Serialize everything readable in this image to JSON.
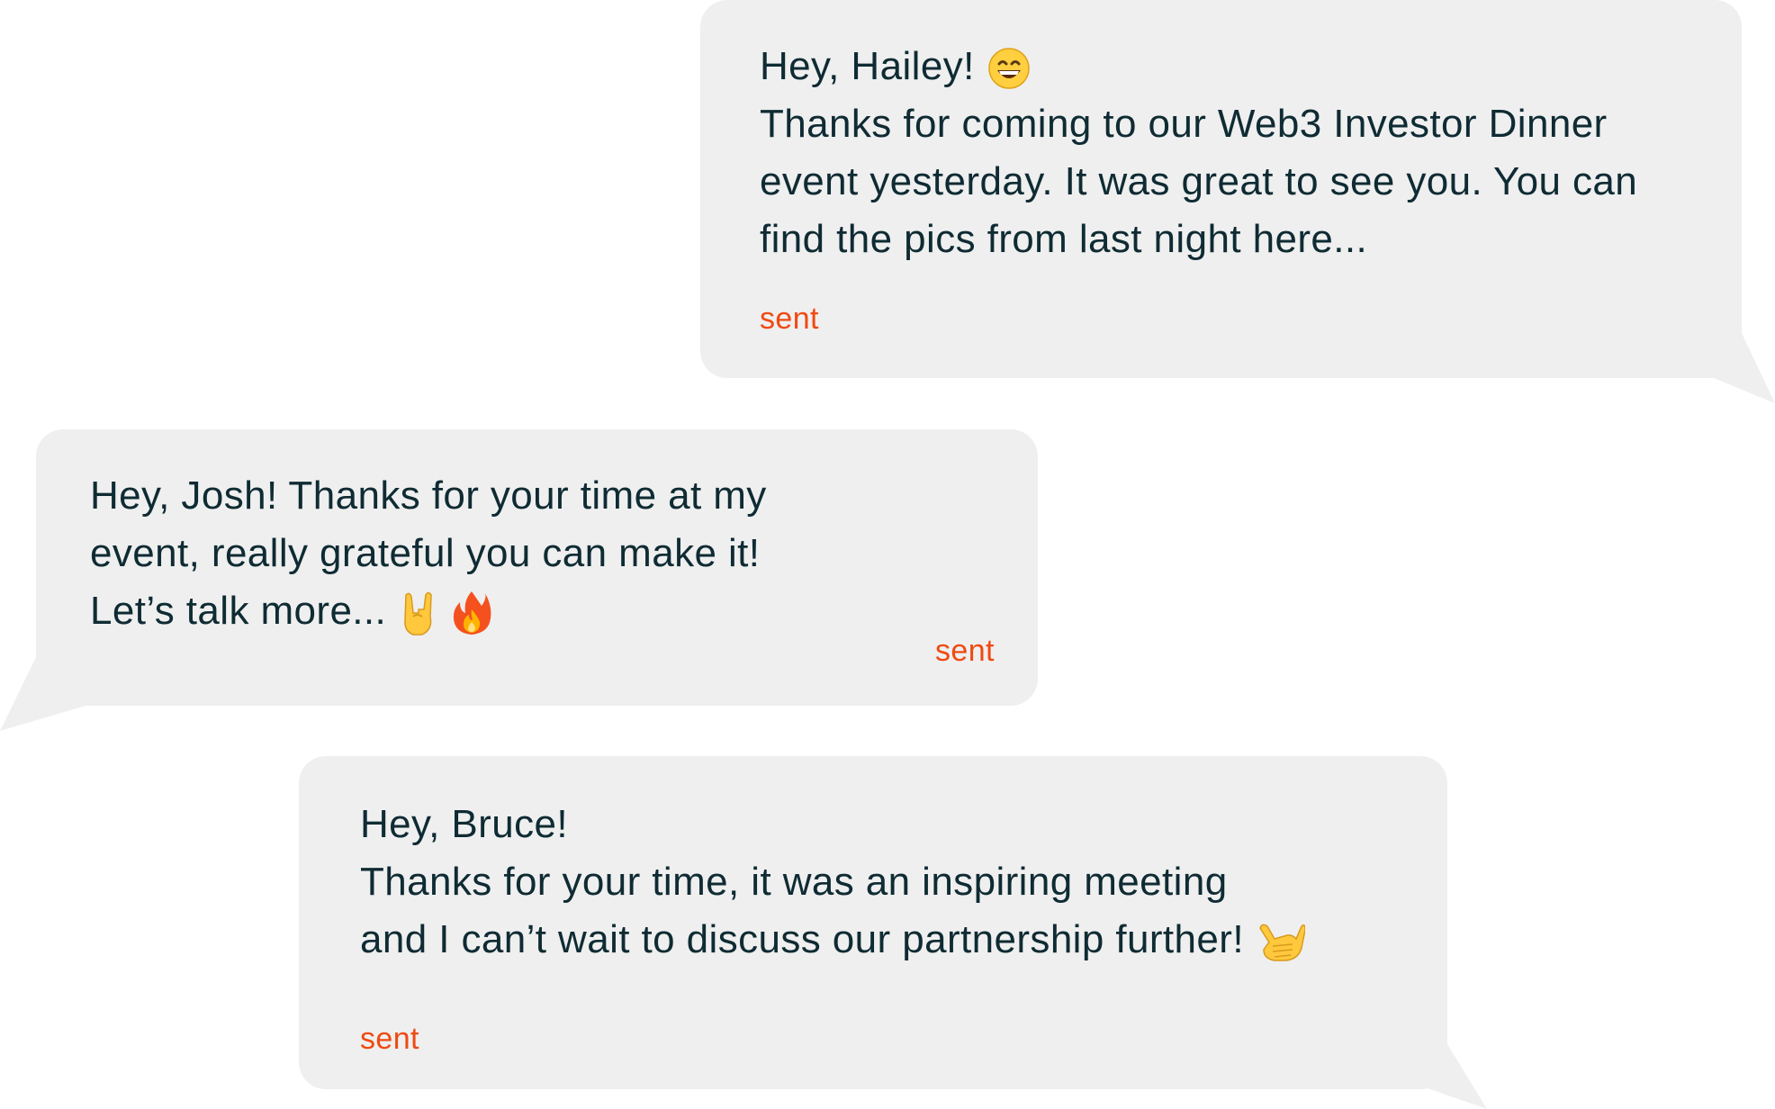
{
  "messages": [
    {
      "lines": [
        "Hey, Hailey!",
        "Thanks for coming to our Web3 Investor Dinner",
        "event yesterday. It was great to see you. You can",
        "find the pics from last night here..."
      ],
      "emojis": [
        "grinning-face"
      ],
      "status": "sent"
    },
    {
      "lines": [
        "Hey, Josh! Thanks for your time at my",
        "event, really grateful you can make it!",
        "Let’s talk more..."
      ],
      "emojis": [
        "sign-of-the-horns",
        "fire"
      ],
      "status": "sent"
    },
    {
      "lines": [
        "Hey, Bruce!",
        "Thanks for your time, it was an inspiring meeting",
        "and I can’t wait to discuss our partnership further!"
      ],
      "emojis": [
        "call-me-hand"
      ],
      "status": "sent"
    }
  ],
  "colors": {
    "bubble": "#efefef",
    "text": "#0f2b33",
    "status": "#ef4a12",
    "background": "#ffffff"
  }
}
